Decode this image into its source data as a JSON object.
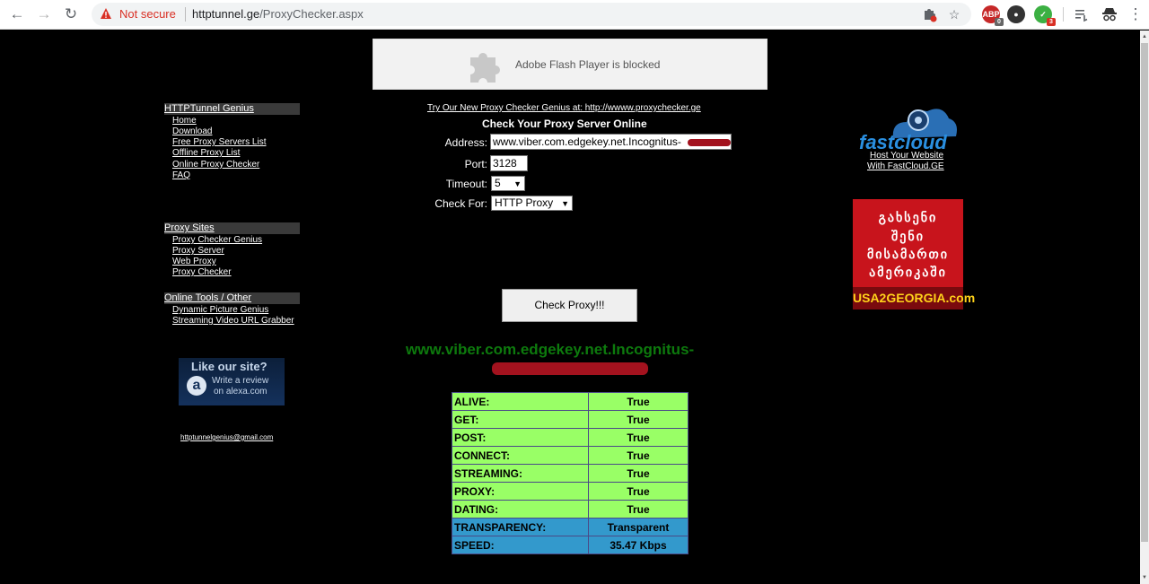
{
  "browser": {
    "not_secure": "Not secure",
    "url_host": "httptunnel.ge",
    "url_path": "/ProxyChecker.aspx",
    "back_icon": "←",
    "forward_icon": "→",
    "reload_icon": "↻",
    "star_icon": "☆",
    "ext_abp_badge": "0",
    "ext_green_badge": "3"
  },
  "flash": {
    "message": "Adobe Flash Player is blocked"
  },
  "sidebar": {
    "sections": [
      {
        "title": "HTTPTunnel Genius",
        "links": [
          "Home",
          "Download",
          "Free Proxy Servers List",
          "Offline Proxy List",
          "Online Proxy Checker",
          "FAQ"
        ]
      },
      {
        "title": "Proxy Sites",
        "links": [
          "Proxy Checker Genius",
          "Proxy Server",
          "Web Proxy",
          "Proxy Checker"
        ]
      },
      {
        "title": "Online Tools / Other",
        "links": [
          "Dynamic Picture Genius",
          "Streaming Video URL Grabber"
        ]
      }
    ],
    "alexa": {
      "title": "Like our site?",
      "logo": "a",
      "line1": "Write a review",
      "line2": "on alexa.com"
    },
    "email": "httptunnelgenius@gmail.com"
  },
  "form": {
    "promo": "Try Our New Proxy Checker Genius at: http://wwww.proxychecker.ge",
    "title": "Check Your Proxy Server Online",
    "address_label": "Address:",
    "address_value": "www.viber.com.edgekey.net.Incognitus-",
    "port_label": "Port:",
    "port_value": "3128",
    "timeout_label": "Timeout:",
    "timeout_value": "5",
    "checkfor_label": "Check For:",
    "checkfor_value": "HTTP Proxy",
    "button": "Check Proxy!!!"
  },
  "result": {
    "host": "www.viber.com.edgekey.net.Incognitus-",
    "rows": [
      {
        "label": "ALIVE:",
        "value": "True"
      },
      {
        "label": "GET:",
        "value": "True"
      },
      {
        "label": "POST:",
        "value": "True"
      },
      {
        "label": "CONNECT:",
        "value": "True"
      },
      {
        "label": "STREAMING:",
        "value": "True"
      },
      {
        "label": "PROXY:",
        "value": "True"
      },
      {
        "label": "DATING:",
        "value": "True"
      },
      {
        "label": "TRANSPARENCY:",
        "value": "Transparent"
      },
      {
        "label": "SPEED:",
        "value": "35.47 Kbps"
      }
    ]
  },
  "ads": {
    "fastcloud_logo": "fastcloud",
    "fastcloud_link1": "Host Your Website",
    "fastcloud_link2": "With FastCloud.GE",
    "usa_lines": [
      "გახსენი",
      "შენი",
      "მისამართი",
      "ამერიკაში"
    ],
    "usa_footer": "USA2GEORGIA.com"
  },
  "colors": {
    "result_true_bg": "#99ff66",
    "result_info_bg": "#3399cc",
    "host_text": "#0d7a0d",
    "redaction": "#a3121e"
  }
}
